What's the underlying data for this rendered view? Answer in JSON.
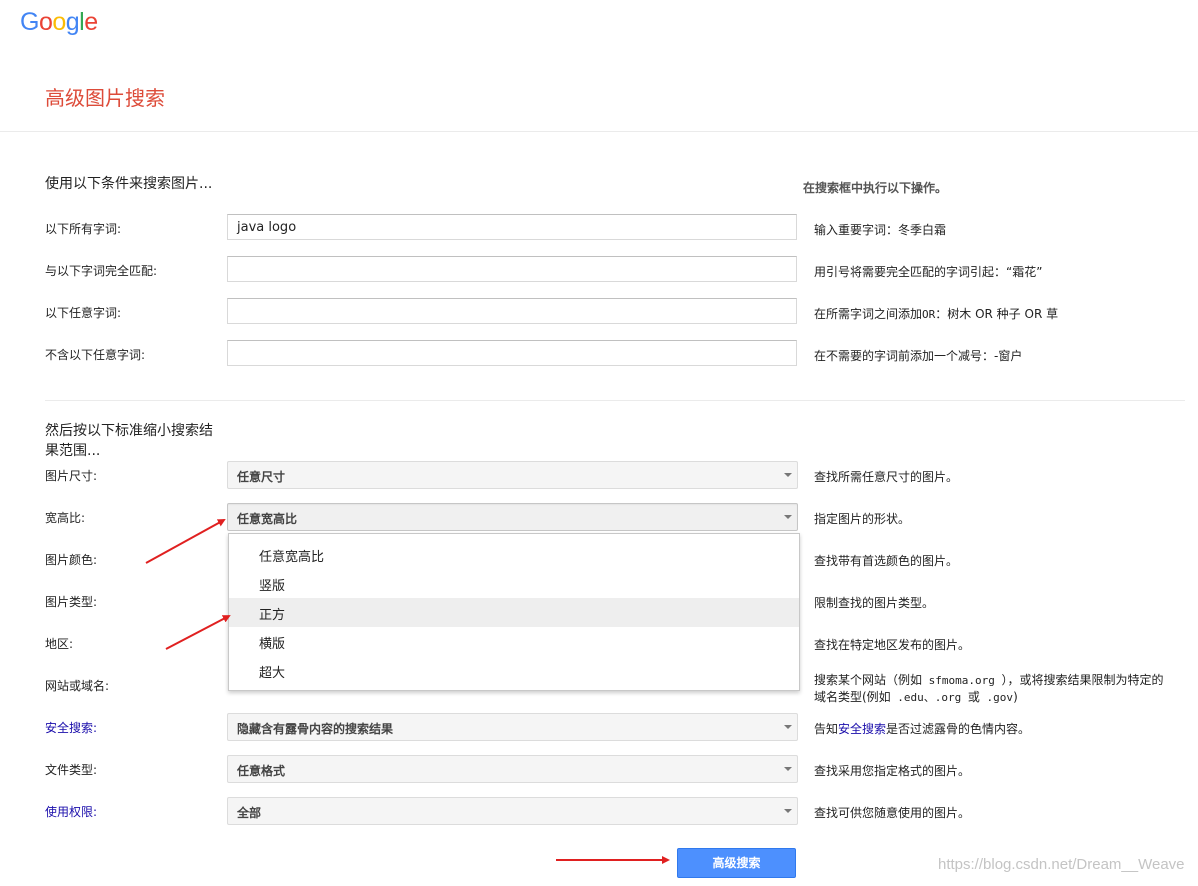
{
  "logo": {
    "letters": [
      "G",
      "o",
      "o",
      "g",
      "l",
      "e"
    ],
    "colors": [
      "#4285f4",
      "#ea4335",
      "#fbbc05",
      "#4285f4",
      "#34a853",
      "#ea4335"
    ]
  },
  "page_title": "高级图片搜索",
  "section1": {
    "heading": "使用以下条件来搜索图片...",
    "right_heading": "在搜索框中执行以下操作。",
    "rows": [
      {
        "label": "以下所有字词:",
        "value": "java logo",
        "hint": "输入重要字词：冬季白霜"
      },
      {
        "label": "与以下字词完全匹配:",
        "value": "",
        "hint": "用引号将需要完全匹配的字词引起：“霜花”"
      },
      {
        "label": "以下任意字词:",
        "value": "",
        "hint_pre": "在所需字词之间添加",
        "hint_mono": "OR",
        "hint_post": "：树木 OR 种子 OR 草"
      },
      {
        "label": "不含以下任意字词:",
        "value": "",
        "hint": "在不需要的字词前添加一个减号：-窗户"
      }
    ]
  },
  "section2": {
    "heading": "然后按以下标准缩小搜索结果范围...",
    "rows": [
      {
        "label": "图片尺寸:",
        "value": "任意尺寸",
        "hint": "查找所需任意尺寸的图片。"
      },
      {
        "label": "宽高比:",
        "value": "任意宽高比",
        "hint": "指定图片的形状。"
      },
      {
        "label": "图片颜色:",
        "hint": "查找带有首选颜色的图片。"
      },
      {
        "label": "图片类型:",
        "hint": "限制查找的图片类型。"
      },
      {
        "label": "地区:",
        "hint": "查找在特定地区发布的图片。"
      },
      {
        "label": "网站或域名:",
        "hint_pre": "搜索某个网站（例如",
        "hint_mono1": " sfmoma.org ",
        "hint_mid": "），或将搜索结果限制为特定的域名类型(例如",
        "hint_mono2": " .edu、.org ",
        "hint_or": "或",
        "hint_mono3": " .gov",
        "hint_end": ")"
      },
      {
        "label": "安全搜索:",
        "value": "隐藏含有露骨内容的搜索结果",
        "hint_pre": "告知",
        "hint_link": "安全搜索",
        "hint_post": "是否过滤露骨的色情内容。"
      },
      {
        "label": "文件类型:",
        "value": "任意格式",
        "hint": "查找采用您指定格式的图片。"
      },
      {
        "label": "使用权限:",
        "value": "全部",
        "hint": "查找可供您随意使用的图片。"
      }
    ]
  },
  "dropdown": {
    "options": [
      "任意宽高比",
      "竖版",
      "正方",
      "横版",
      "超大"
    ],
    "highlighted_index": 2
  },
  "submit_label": "高级搜索",
  "watermark": "https://blog.csdn.net/Dream__Weave",
  "annotation_color": "#e02020"
}
